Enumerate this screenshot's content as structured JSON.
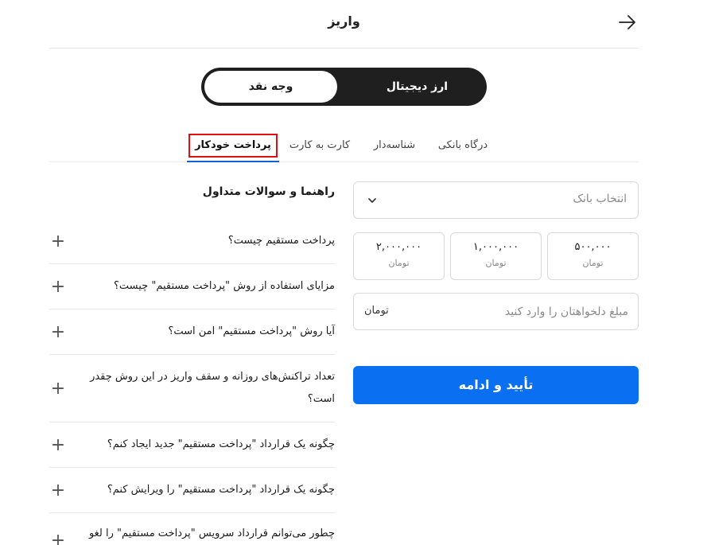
{
  "header": {
    "title": "واریز"
  },
  "toggle": {
    "crypto": "ارز دیجیتال",
    "cash": "وجه نقد"
  },
  "tabs": [
    {
      "label": "درگاه بانکی"
    },
    {
      "label": "شناسه‌دار"
    },
    {
      "label": "کارت به کارت"
    },
    {
      "label": "پرداخت خودکار"
    }
  ],
  "form": {
    "bank_select": "انتخاب بانک",
    "amounts": [
      {
        "value": "۵۰۰,۰۰۰",
        "unit": "تومان"
      },
      {
        "value": "۱,۰۰۰,۰۰۰",
        "unit": "تومان"
      },
      {
        "value": "۲,۰۰۰,۰۰۰",
        "unit": "تومان"
      }
    ],
    "custom_placeholder": "مبلغ دلخواهتان را وارد کنید",
    "custom_unit": "تومان",
    "submit": "تأیید و ادامه"
  },
  "faq": {
    "title": "راهنما و سوالات متداول",
    "items": [
      {
        "q": "پرداخت مستقیم چیست؟"
      },
      {
        "q": "مزایای استفاده از روش \"پرداخت مستقیم\" چیست؟"
      },
      {
        "q": "آیا روش \"پرداخت مستقیم\" امن است؟"
      },
      {
        "q": "تعداد تراکنش‌های روزانه و سقف واریز در این روش چقدر است؟"
      },
      {
        "q": "چگونه یک قرارداد \"پرداخت مستقیم\" جدید ایجاد کنم؟"
      },
      {
        "q": "چگونه یک قرارداد \"پرداخت مستقیم\" را ویرایش کنم؟"
      },
      {
        "q": "چطور می‌توانم قرارداد سرویس \"پرداخت مستقیم\" را لغو"
      }
    ]
  }
}
